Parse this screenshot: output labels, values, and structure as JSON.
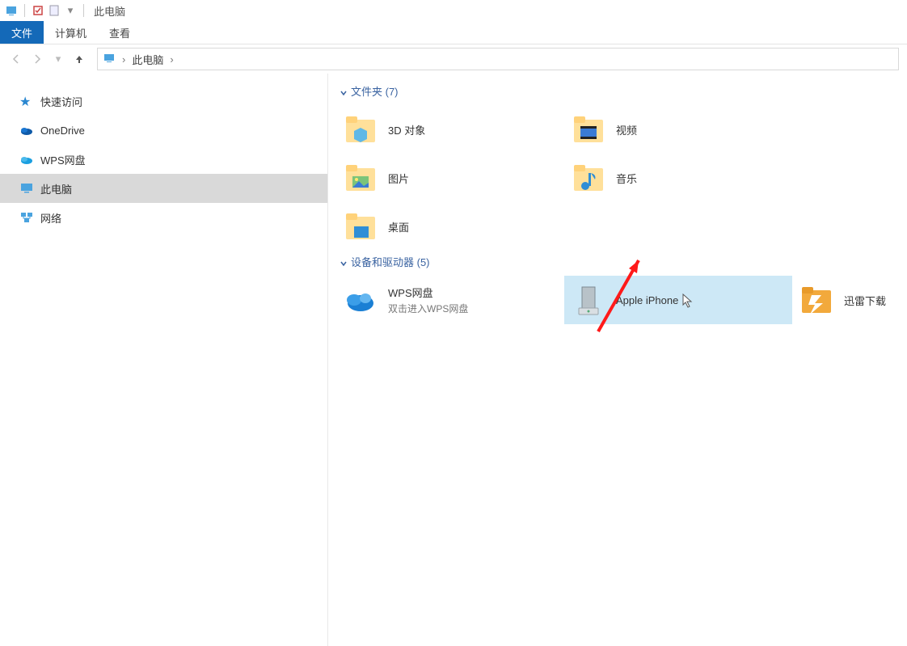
{
  "titlebar": {
    "title": "此电脑"
  },
  "ribbon": {
    "file": "文件",
    "computer": "计算机",
    "view": "查看"
  },
  "breadcrumb": {
    "root": "此电脑"
  },
  "sidebar": {
    "items": [
      {
        "label": "快速访问",
        "icon": "star"
      },
      {
        "label": "OneDrive",
        "icon": "cloud-blue"
      },
      {
        "label": "WPS网盘",
        "icon": "cloud-cyan"
      },
      {
        "label": "此电脑",
        "icon": "pc",
        "selected": true
      },
      {
        "label": "网络",
        "icon": "net"
      }
    ]
  },
  "groups": {
    "folders": {
      "header": "文件夹 (7)",
      "items": [
        {
          "label": "3D 对象",
          "icon": "3d"
        },
        {
          "label": "视频",
          "icon": "video"
        },
        {
          "label": "图片",
          "icon": "pictures"
        },
        {
          "label": "音乐",
          "icon": "music"
        },
        {
          "label": "桌面",
          "icon": "desktop"
        }
      ]
    },
    "devices": {
      "header": "设备和驱动器 (5)",
      "items": [
        {
          "label": "WPS网盘",
          "sub": "双击进入WPS网盘",
          "icon": "wps-cloud"
        },
        {
          "label": "Apple iPhone",
          "icon": "drive",
          "selected": true
        },
        {
          "label": "迅雷下载",
          "icon": "thunder"
        }
      ]
    }
  }
}
